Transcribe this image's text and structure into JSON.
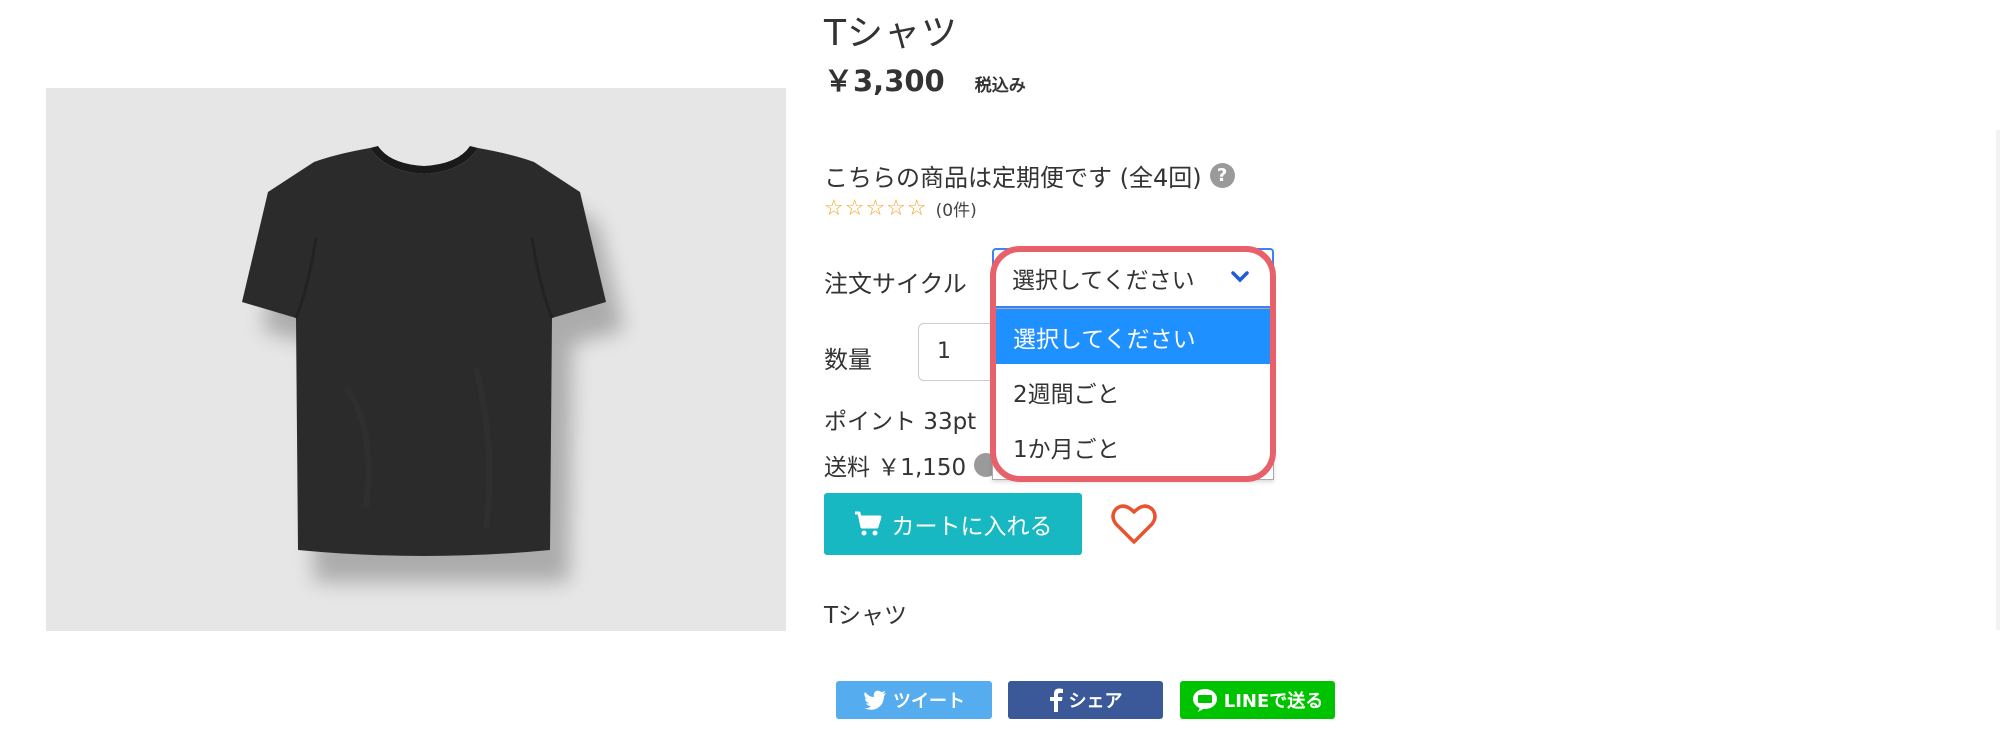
{
  "product": {
    "title": "Tシャツ",
    "price": "￥3,300",
    "tax_label": "税込み",
    "subscription_text": "こちらの商品は定期便です (全4回)",
    "help_icon_text": "?",
    "rating_stars": "☆☆☆☆☆",
    "review_count": "(0件)",
    "description": "Tシャツ"
  },
  "order": {
    "cycle_label": "注文サイクル",
    "quantity_label": "数量",
    "quantity_value": "1",
    "points_text": "ポイント 33pt",
    "shipping_text": "送料 ￥1,150"
  },
  "select": {
    "current": "選択してください",
    "options": [
      "選択してください",
      "2週間ごと",
      "1か月ごと"
    ],
    "selected_index": 0
  },
  "actions": {
    "cart_label": "カートに入れる",
    "tweet_label": "ツイート",
    "share_label": "シェア",
    "line_label": "LINEで送る"
  },
  "colors": {
    "cart": "#17b8c2",
    "highlight": "#e8606a",
    "option_selected": "#1e90ff",
    "heart": "#e8542f"
  }
}
